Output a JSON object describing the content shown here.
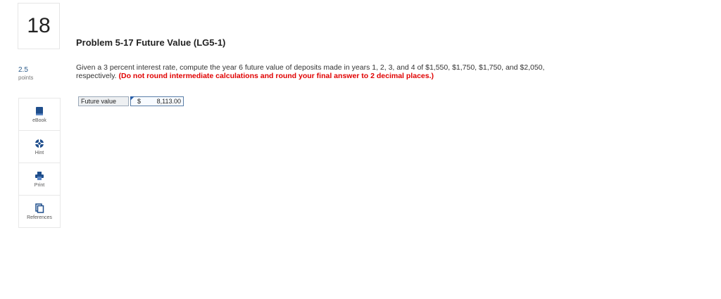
{
  "question": {
    "number": "18",
    "points_value": "2.5",
    "points_label": "points"
  },
  "tools": [
    {
      "label": "eBook",
      "icon": "book-icon"
    },
    {
      "label": "Hint",
      "icon": "lifebuoy-icon"
    },
    {
      "label": "Print",
      "icon": "printer-icon"
    },
    {
      "label": "References",
      "icon": "copy-icon"
    }
  ],
  "problem": {
    "title": "Problem 5-17 Future Value (LG5-1)",
    "text": "Given a 3 percent interest rate, compute the year 6 future value of deposits made in years 1, 2, 3, and 4 of $1,550, $1,750, $1,750, and $2,050, respectively.",
    "instruction": "(Do not round intermediate calculations and round your final answer to 2 decimal places.)"
  },
  "answer": {
    "label": "Future value",
    "currency": "$",
    "value": "8,113.00"
  },
  "colors": {
    "accent_blue": "#2a5fa8",
    "instruction_red": "#e00000",
    "book_icon_blue": "#1f4e8c"
  }
}
